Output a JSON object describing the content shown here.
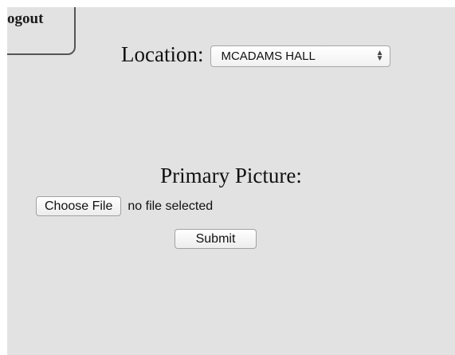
{
  "header": {
    "logout_label": "ogout"
  },
  "location": {
    "label": "Location:",
    "selected": "MCADAMS HALL",
    "arrow_icon": "up-down-chevron-icon"
  },
  "picture": {
    "label": "Primary Picture:",
    "choose_button": "Choose File",
    "file_status": "no file selected"
  },
  "form": {
    "submit_label": "Submit"
  }
}
